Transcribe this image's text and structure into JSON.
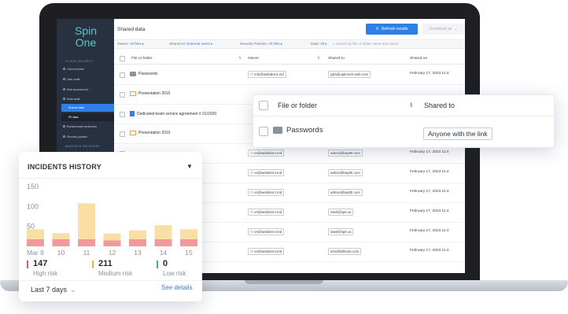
{
  "app": {
    "logo_line1": "Spin",
    "logo_line2": "One",
    "page_title": "Shared data"
  },
  "sidebar": {
    "section_security": "CLOUD SECURITY",
    "items": [
      {
        "label": "Cloud monitor"
      },
      {
        "label": "User audit"
      },
      {
        "label": "Risk Assessment"
      },
      {
        "label": "Data audit"
      }
    ],
    "subitems": [
      {
        "label": "Shared data",
        "active": true
      },
      {
        "label": "PII data",
        "active": false
      }
    ],
    "items_after": [
      {
        "label": "Ransomware protection"
      },
      {
        "label": "Security policies"
      }
    ],
    "section_backup": "BACKUP & RECOVERY"
  },
  "toolbar": {
    "refresh_label": "Refresh results",
    "download_label": "Download as"
  },
  "filters": {
    "owner_label": "Owner:",
    "owner_value": "All files",
    "shared_label": "Shared to:",
    "shared_value": "External users",
    "policies_label": "Security Policies:",
    "policies_value": "All files",
    "date_label": "Date:",
    "date_value": "All",
    "search_placeholder": "Search by file or folder name and owner"
  },
  "table": {
    "headers": [
      "File or folder",
      "Owner",
      "Shared to",
      "Shared on"
    ],
    "rows": [
      {
        "file": "Passwords",
        "type": "folder",
        "owner": "info@webdirect.md",
        "shared_to": "julia@optimum-web.com",
        "date": "February 17, 2023 11:4"
      },
      {
        "file": "Presentation 2015",
        "type": "presentation",
        "owner": "",
        "shared_to": "",
        "date": ""
      },
      {
        "file": "Dedicated team service agreement # 01/2020",
        "type": "document",
        "owner": "",
        "shared_to": "",
        "date": ""
      },
      {
        "file": "Presentation 2015",
        "type": "presentation",
        "owner": "",
        "shared_to": "",
        "date": ""
      },
      {
        "file": "",
        "type": "",
        "owner": "vs@webdirect.md",
        "shared_to": "admin@bay80.com",
        "date": "February 17, 2023 11:4"
      },
      {
        "file": "",
        "type": "",
        "owner": "vs@webdirect.md",
        "shared_to": "admin@bay80.com",
        "date": "February 17, 2023 11:4"
      },
      {
        "file": "",
        "type": "",
        "owner": "vs@webdirect.md",
        "shared_to": "admin@bay80.com",
        "date": "February 17, 2023 11:4"
      },
      {
        "file": "",
        "type": "",
        "owner": "vs@webdirect.md",
        "shared_to": "davit@spin.ai",
        "date": "February 17, 2023 11:4"
      },
      {
        "file": "",
        "type": "",
        "owner": "vs@webdirect.md",
        "shared_to": "davit@spin.ai",
        "date": "February 17, 2023 11:4"
      },
      {
        "file": "",
        "type": "",
        "owner": "vs@webdirect.md",
        "shared_to": "info@billmoto.com",
        "date": "February 17, 2023 11:4"
      }
    ]
  },
  "popup": {
    "col_file": "File or folder",
    "col_shared": "Shared to",
    "row_file": "Passwords",
    "row_shared": "Anyone with the link"
  },
  "incidents": {
    "title": "INCIDENTS HISTORY",
    "period": "Last 7 days",
    "see_details": "See details",
    "high_count": "147",
    "high_label": "High risk",
    "medium_count": "211",
    "medium_label": "Medium risk",
    "low_count": "0",
    "low_label": "Low risk",
    "colors": {
      "high": "#f29a9a",
      "medium": "#f9dfa6",
      "low": "#6cc98b",
      "high_marker": "#e05a5a",
      "medium_marker": "#f0b43c",
      "low_marker": "#4cb36e"
    }
  },
  "chart_data": {
    "type": "bar",
    "categories": [
      "Mar 9",
      "10",
      "11",
      "12",
      "13",
      "14",
      "15"
    ],
    "series": [
      {
        "name": "High risk",
        "values": [
          18,
          18,
          18,
          15,
          18,
          18,
          18
        ]
      },
      {
        "name": "Medium risk",
        "values": [
          25,
          15,
          90,
          17,
          22,
          35,
          25
        ]
      }
    ],
    "yticks": [
      "150",
      "100",
      "50"
    ],
    "ylim": [
      0,
      150
    ],
    "stacked": true
  }
}
